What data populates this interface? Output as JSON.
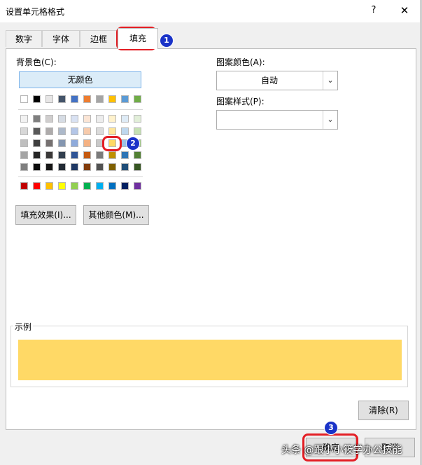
{
  "dialog": {
    "title": "设置单元格格式",
    "help": "?",
    "close": "✕"
  },
  "tabs": [
    "数字",
    "字体",
    "边框",
    "填充"
  ],
  "fill": {
    "background_label": "背景色(C):",
    "no_color": "无颜色",
    "pattern_color_label": "图案颜色(A):",
    "pattern_color_value": "自动",
    "pattern_style_label": "图案样式(P):",
    "pattern_style_value": "",
    "fill_effects_button": "填充效果(I)...",
    "more_colors_button": "其他颜色(M)...",
    "sample_label": "示例",
    "sample_color": "#ffd966",
    "clear_button": "清除(R)",
    "ok_button": "确定",
    "cancel_button": "取消"
  },
  "palette": {
    "theme_top": [
      "#ffffff",
      "#000000",
      "#e7e6e6",
      "#44546a",
      "#4472c4",
      "#ed7d31",
      "#a5a5a5",
      "#ffc000",
      "#5b9bd5",
      "#70ad47"
    ],
    "theme_shades": [
      [
        "#f2f2f2",
        "#7f7f7f",
        "#d0cece",
        "#d6dce4",
        "#d9e2f3",
        "#fbe5d5",
        "#ededed",
        "#fff2cc",
        "#deebf6",
        "#e2efd9"
      ],
      [
        "#d8d8d8",
        "#595959",
        "#aeabab",
        "#adb9ca",
        "#b4c6e7",
        "#f7cbac",
        "#dbdbdb",
        "#fee599",
        "#bdd7ee",
        "#c5e0b3"
      ],
      [
        "#bfbfbf",
        "#3f3f3f",
        "#757070",
        "#8496b0",
        "#8eaadb",
        "#f4b183",
        "#c9c9c9",
        "#ffd966",
        "#9cc3e5",
        "#a8d08d"
      ],
      [
        "#a5a5a5",
        "#262626",
        "#3a3838",
        "#323f4f",
        "#2f5496",
        "#c55a11",
        "#7b7b7b",
        "#bf9000",
        "#2e75b5",
        "#538135"
      ],
      [
        "#7f7f7f",
        "#0c0c0c",
        "#171616",
        "#222a35",
        "#1f3864",
        "#833c0b",
        "#525252",
        "#7f6000",
        "#1f4e79",
        "#375623"
      ]
    ],
    "standard": [
      "#c00000",
      "#ff0000",
      "#ffc000",
      "#ffff00",
      "#92d050",
      "#00b050",
      "#00b0f0",
      "#0070c0",
      "#002060",
      "#7030a0"
    ]
  },
  "annotations": {
    "step1": "1",
    "step2": "2",
    "step3": "3"
  },
  "watermark": "头条 @跟小小筱学办公技能"
}
